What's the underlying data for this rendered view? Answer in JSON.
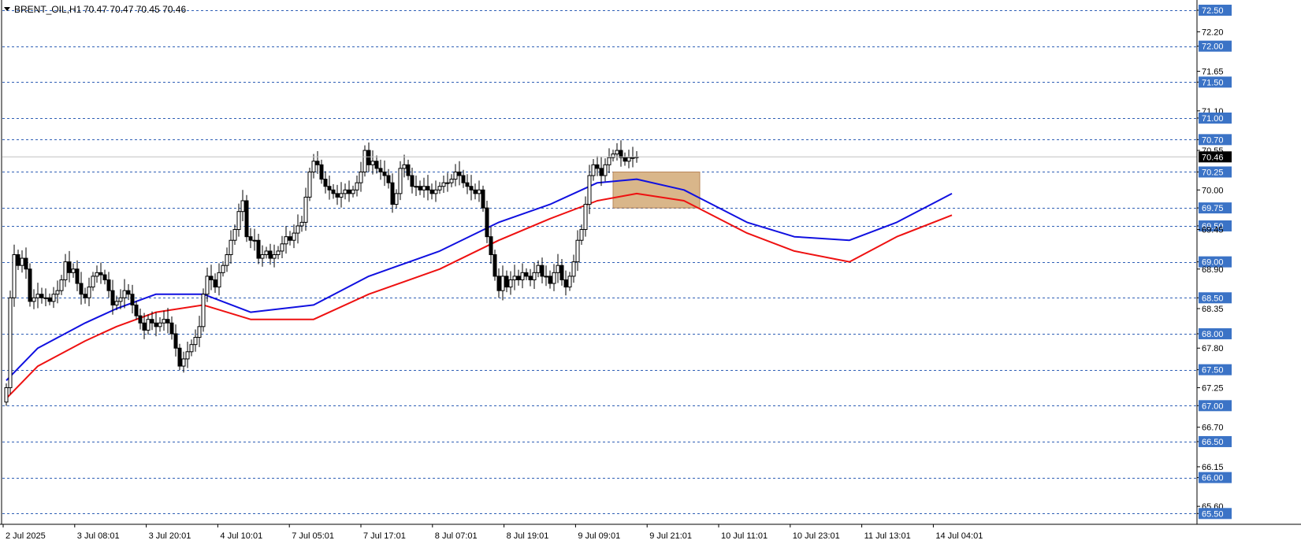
{
  "header": {
    "symbol_timeframe": "BRENT_OIL,H1",
    "ohlc": "70.47 70.47 70.45 70.46"
  },
  "colors": {
    "background": "#ffffff",
    "level_line": "#2f5fb5",
    "ma_fast": "#1010e0",
    "ma_slow": "#ee1111",
    "zone": "#d9b68a",
    "zone_border": "#b9875a",
    "price_badge": "#000000",
    "level_badge": "#3b73c6"
  },
  "chart_data": {
    "type": "candlestick",
    "y_range": [
      65.35,
      72.62
    ],
    "y_ticks": [
      "72.50",
      "72.20",
      "72.00",
      "71.65",
      "71.50",
      "71.10",
      "71.00",
      "70.70",
      "70.55",
      "70.46",
      "70.25",
      "70.00",
      "69.75",
      "69.50",
      "69.45",
      "69.00",
      "68.90",
      "68.50",
      "68.35",
      "68.00",
      "67.80",
      "67.50",
      "67.25",
      "67.00",
      "66.70",
      "66.50",
      "66.15",
      "66.00",
      "65.60",
      "65.50"
    ],
    "highlighted_levels": [
      "72.50",
      "72.00",
      "71.50",
      "71.00",
      "70.70",
      "70.25",
      "69.75",
      "69.50",
      "69.00",
      "68.50",
      "68.00",
      "67.50",
      "67.00",
      "66.50",
      "66.00",
      "65.50"
    ],
    "current_price": "70.46",
    "x_labels": [
      "2 Jul 2025",
      "3 Jul 08:01",
      "3 Jul 20:01",
      "4 Jul 10:01",
      "7 Jul 05:01",
      "7 Jul 17:01",
      "8 Jul 07:01",
      "8 Jul 19:01",
      "9 Jul 09:01",
      "9 Jul 21:01",
      "10 Jul 11:01",
      "10 Jul 23:01",
      "11 Jul 13:01",
      "14 Jul 04:01"
    ],
    "zone": {
      "low": 69.75,
      "high": 70.25,
      "start_bar": 154,
      "end_bar": 176
    },
    "closes": [
      67.25,
      68.5,
      69.1,
      68.95,
      69.05,
      68.9,
      68.45,
      68.5,
      68.55,
      68.5,
      68.5,
      68.45,
      68.55,
      68.6,
      68.75,
      69.0,
      68.85,
      68.9,
      68.7,
      68.55,
      68.5,
      68.65,
      68.8,
      68.85,
      68.82,
      68.75,
      68.6,
      68.4,
      68.45,
      68.5,
      68.6,
      68.55,
      68.4,
      68.25,
      68.15,
      68.05,
      68.2,
      68.15,
      68.1,
      68.15,
      68.2,
      68.15,
      68.0,
      67.8,
      67.55,
      67.65,
      67.75,
      67.85,
      67.95,
      68.1,
      68.55,
      68.8,
      68.75,
      68.65,
      68.85,
      68.95,
      69.1,
      69.3,
      69.45,
      69.7,
      69.85,
      69.35,
      69.3,
      69.3,
      69.05,
      69.1,
      69.15,
      69.05,
      69.1,
      69.15,
      69.25,
      69.35,
      69.3,
      69.4,
      69.5,
      69.55,
      69.9,
      70.25,
      70.4,
      70.35,
      70.15,
      70.05,
      70.0,
      69.95,
      69.9,
      69.95,
      70.0,
      69.95,
      70.0,
      70.1,
      70.25,
      70.55,
      70.35,
      70.4,
      70.3,
      70.25,
      70.2,
      70.1,
      69.8,
      69.95,
      70.3,
      70.35,
      70.2,
      70.05,
      70.05,
      70.0,
      70.05,
      70.0,
      69.95,
      70.0,
      70.05,
      70.1,
      70.1,
      70.15,
      70.25,
      70.2,
      70.1,
      70.05,
      70.0,
      69.95,
      70.0,
      69.75,
      69.35,
      69.1,
      68.8,
      68.6,
      68.8,
      68.65,
      68.75,
      68.8,
      68.75,
      68.85,
      68.8,
      68.75,
      68.85,
      68.95,
      68.8,
      68.8,
      68.7,
      68.85,
      68.95,
      68.75,
      68.65,
      68.8,
      69.0,
      69.3,
      69.45,
      69.8,
      70.2,
      70.35,
      70.3,
      70.2,
      70.35,
      70.45,
      70.5,
      70.55,
      70.45,
      70.4,
      70.45,
      70.45,
      70.46
    ],
    "ma_fast": {
      "start": 67.35,
      "points": [
        [
          0,
          67.35
        ],
        [
          8,
          67.8
        ],
        [
          20,
          68.15
        ],
        [
          28,
          68.35
        ],
        [
          38,
          68.55
        ],
        [
          50,
          68.55
        ],
        [
          62,
          68.3
        ],
        [
          78,
          68.4
        ],
        [
          92,
          68.8
        ],
        [
          110,
          69.15
        ],
        [
          125,
          69.55
        ],
        [
          138,
          69.8
        ],
        [
          150,
          70.1
        ],
        [
          160,
          70.15
        ],
        [
          172,
          70.0
        ],
        [
          188,
          69.55
        ],
        [
          200,
          69.35
        ],
        [
          214,
          69.3
        ],
        [
          226,
          69.55
        ],
        [
          240,
          69.95
        ]
      ]
    },
    "ma_slow": {
      "start": 67.1,
      "points": [
        [
          0,
          67.1
        ],
        [
          8,
          67.55
        ],
        [
          20,
          67.9
        ],
        [
          28,
          68.1
        ],
        [
          38,
          68.3
        ],
        [
          50,
          68.4
        ],
        [
          62,
          68.2
        ],
        [
          78,
          68.2
        ],
        [
          92,
          68.55
        ],
        [
          110,
          68.9
        ],
        [
          125,
          69.3
        ],
        [
          138,
          69.6
        ],
        [
          150,
          69.85
        ],
        [
          160,
          69.95
        ],
        [
          172,
          69.85
        ],
        [
          188,
          69.4
        ],
        [
          200,
          69.15
        ],
        [
          214,
          69.0
        ],
        [
          226,
          69.35
        ],
        [
          240,
          69.65
        ]
      ]
    }
  }
}
